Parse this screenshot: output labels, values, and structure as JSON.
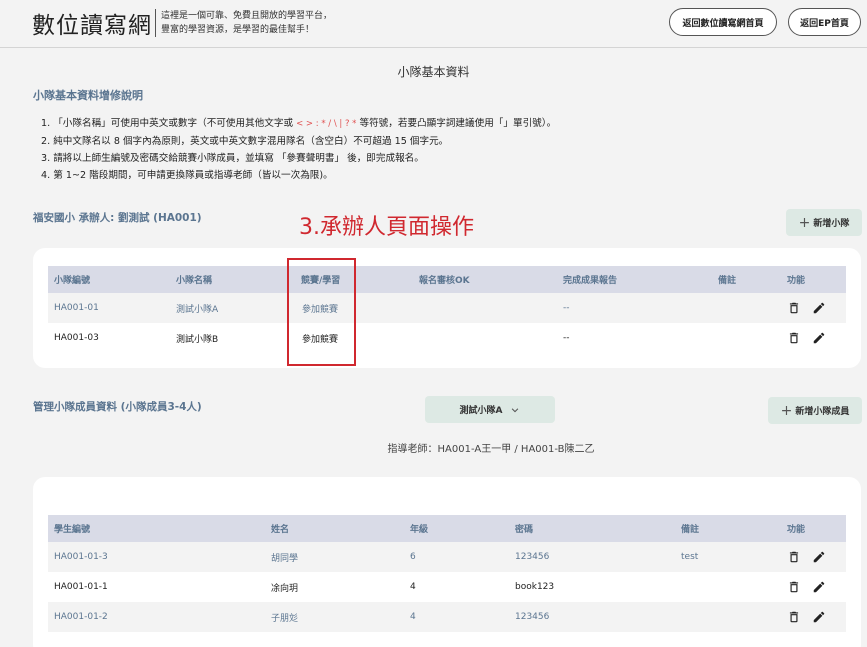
{
  "header": {
    "logo": "數位讀寫網",
    "slogan_line1": "這裡是一個可靠、免費且開放的學習平台，",
    "slogan_line2": "豐富的學習資源，是學習的最佳幫手！",
    "btn_home": "返回數位讀寫網首頁",
    "btn_ep": "返回EP首頁"
  },
  "page_title": "小隊基本資料",
  "instructions": {
    "heading": "小隊基本資料增修說明",
    "item1_prefix": "1. 「小隊名稱」可使用中英文或數字（不可使用其他文字或",
    "item1_chars": "< > : * / \\ | ? *",
    "item1_suffix": "等符號，若要凸顯字詞建議使用「」單引號）。",
    "item2": "2. 純中文隊名以 8 個字內為原則，英文或中英文數字混用隊名（含空白）不可超過 15 個字元。",
    "item3": "3. 請將以上師生編號及密碼交給競賽小隊成員，並填寫 「參賽聲明書」 後，即完成報名。",
    "item4": "4. 第 1~2 階段期間，可申請更換隊員或指導老師（皆以一次為限)。"
  },
  "team_section": {
    "title": "福安國小 承辦人: 劉測試 (HA001)",
    "add_button": "新增小隊",
    "annotation": "3.承辦人頁面操作",
    "headers": [
      "小隊編號",
      "小隊名稱",
      "競賽/學習",
      "報名審核OK",
      "完成成果報告",
      "備註",
      "功能"
    ],
    "rows": [
      {
        "id": "HA001-01",
        "name": "測試小隊A",
        "mode": "參加競賽",
        "review": "",
        "report": "--",
        "note": ""
      },
      {
        "id": "HA001-03",
        "name": "測試小隊B",
        "mode": "參加競賽",
        "review": "",
        "report": "--",
        "note": ""
      }
    ]
  },
  "member_section": {
    "title": "管理小隊成員資料 (小隊成員3-4人)",
    "team_select": "測試小隊A",
    "add_button": "新增小隊成員",
    "advisor": "指導老師：HA001-A王一甲 / HA001-B陳二乙",
    "headers": [
      "學生編號",
      "姓名",
      "年級",
      "密碼",
      "備註",
      "功能"
    ],
    "rows": [
      {
        "id": "HA001-01-3",
        "name": "胡同學",
        "grade": "6",
        "password": "123456",
        "note": "test"
      },
      {
        "id": "HA001-01-1",
        "name": "凃向玥",
        "grade": "4",
        "password": "book123",
        "note": ""
      },
      {
        "id": "HA001-01-2",
        "name": "子朋彣",
        "grade": "4",
        "password": "123456",
        "note": ""
      }
    ]
  },
  "icons": {
    "delete": "trash-icon",
    "edit": "pencil-icon",
    "dropdown": "chevron-down-icon",
    "add": "plus-icon"
  },
  "colors": {
    "accent": "#5b7590",
    "annotation": "#d0282f",
    "green_button": "#dde9e4",
    "table_header": "#d9dbe7"
  }
}
